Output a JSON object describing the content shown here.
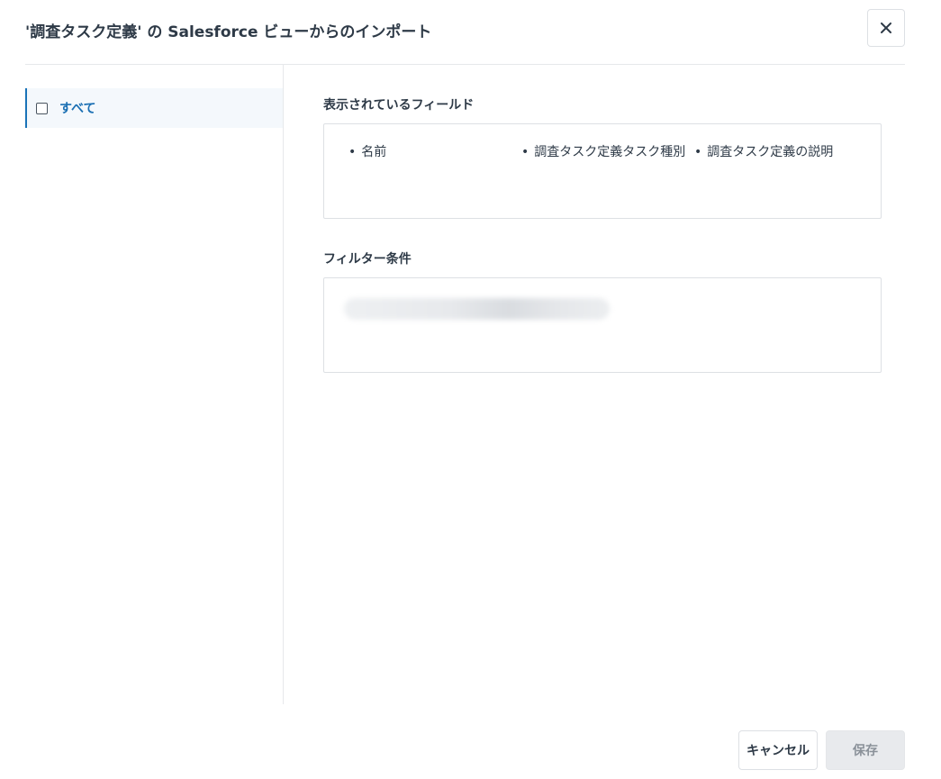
{
  "dialog": {
    "title": "'調査タスク定義' の Salesforce ビューからのインポート",
    "close_icon": "close-icon"
  },
  "sidebar": {
    "items": [
      {
        "label": "すべて",
        "checked": false
      }
    ]
  },
  "main": {
    "fields_section": {
      "title": "表示されているフィールド",
      "fields": [
        "名前",
        "調査タスク定義タスク種別",
        "調査タスク定義の説明"
      ]
    },
    "filter_section": {
      "title": "フィルター条件"
    }
  },
  "footer": {
    "cancel_label": "キャンセル",
    "save_label": "保存"
  },
  "colors": {
    "accent": "#1a6fb3",
    "text": "#2e3a47",
    "border": "#dde0e4",
    "selected_bg": "#f4f8fc"
  }
}
